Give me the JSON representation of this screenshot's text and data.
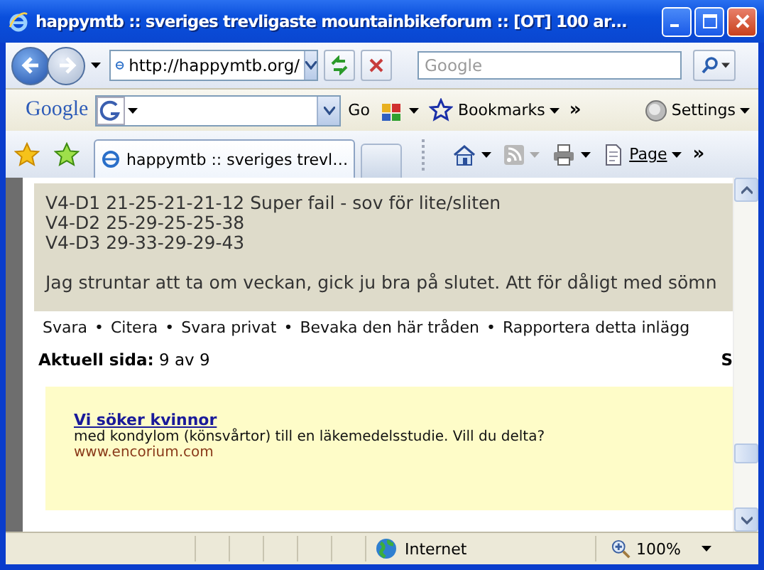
{
  "window": {
    "title": "happymtb :: sveriges trevligaste mountainbikeforum :: [OT] 100 ar…"
  },
  "address_bar": {
    "value": "http://happymtb.org/"
  },
  "search": {
    "placeholder": "Google"
  },
  "google_toolbar": {
    "logo": "Google",
    "go": "Go",
    "bookmarks": "Bookmarks",
    "more": "»",
    "settings": "Settings"
  },
  "tabs": [
    {
      "label": "happymtb :: sveriges trevl…",
      "selected": true
    }
  ],
  "command_bar": {
    "page": "Page",
    "more": "»"
  },
  "post": {
    "lines": [
      "V4-D1 21-25-21-21-12 Super fail - sov för lite/sliten",
      "V4-D2 25-29-25-25-38",
      "V4-D3 29-33-29-29-43"
    ],
    "paragraph": "Jag struntar att ta om veckan, gick ju bra på slutet. Att för dåligt med sömn"
  },
  "post_actions": {
    "separator": "•",
    "items": [
      "Svara",
      "Citera",
      "Svara privat",
      "Bevaka den här tråden",
      "Rapportera detta inlägg"
    ]
  },
  "pagination": {
    "label": "Aktuell sida:",
    "value": "9 av 9",
    "right_text": "S"
  },
  "ad": {
    "title": "Vi söker kvinnor",
    "text": "med kondylom (könsvårtor) till en läkemedelsstudie. Vill du delta?",
    "url": "www.encorium.com"
  },
  "status_bar": {
    "zone": "Internet",
    "zoom": "100%"
  }
}
